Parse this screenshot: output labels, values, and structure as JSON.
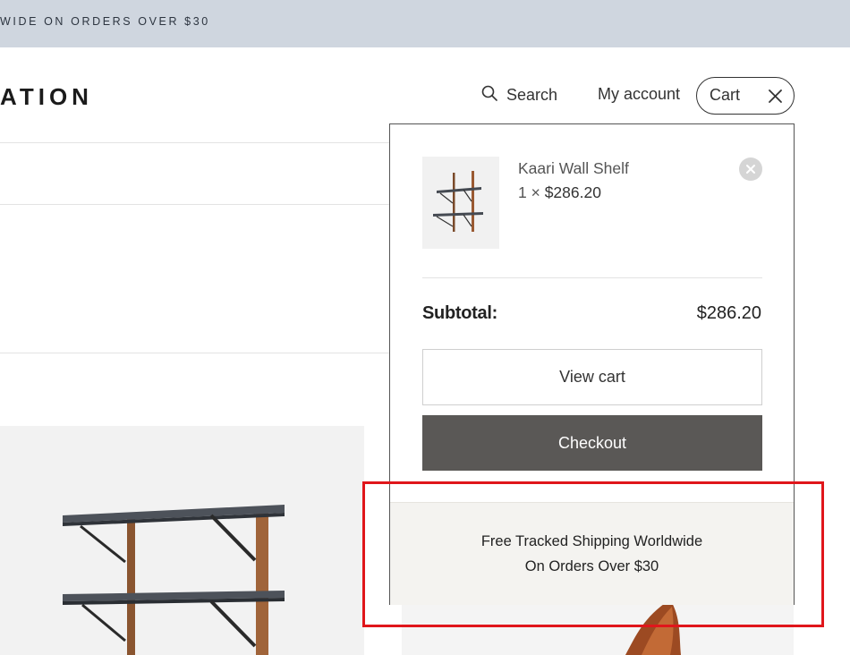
{
  "promo": {
    "text": "WIDE ON ORDERS OVER $30"
  },
  "header": {
    "logo_text": "ATION",
    "search_label": "Search",
    "account_label": "My account",
    "cart_label": "Cart"
  },
  "icons": {
    "search": "search-icon",
    "close": "close-icon",
    "remove": "remove-x-icon"
  },
  "mini_cart": {
    "item": {
      "name": "Kaari Wall Shelf",
      "qty_prefix": "1 ×",
      "price": "$286.20"
    },
    "subtotal_label": "Subtotal:",
    "subtotal_value": "$286.20",
    "view_cart_label": "View cart",
    "checkout_label": "Checkout",
    "shipping_line1": "Free Tracked Shipping Worldwide",
    "shipping_line2": "On Orders Over $30"
  },
  "colors": {
    "promo_bg": "#cfd6df",
    "checkout_bg": "#5a5856",
    "shipping_bg": "#f4f3f0",
    "highlight": "#e0161b"
  }
}
